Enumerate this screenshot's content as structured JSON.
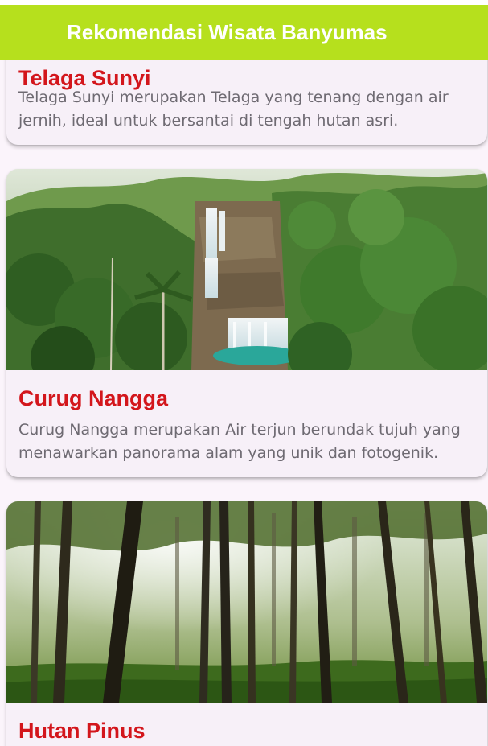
{
  "app_bar": {
    "title": "Rekomendasi Wisata Banyumas",
    "color": "#b6e01d"
  },
  "destinations": [
    {
      "name": "Telaga Sunyi",
      "description": "Telaga Sunyi merupakan Telaga yang tenang dengan air jernih, ideal untuk bersantai di tengah hutan asri.",
      "image": "lake-photo"
    },
    {
      "name": "Curug Nangga",
      "description": "Curug Nangga merupakan Air terjun berundak tujuh yang menawarkan panorama alam yang unik dan fotogenik.",
      "image": "waterfall-photo"
    },
    {
      "name": "Hutan Pinus",
      "description": "",
      "image": "pine-forest-photo"
    }
  ],
  "colors": {
    "title": "#d3161c",
    "description": "#6e6a72",
    "card_background": "#f7f0f8"
  }
}
